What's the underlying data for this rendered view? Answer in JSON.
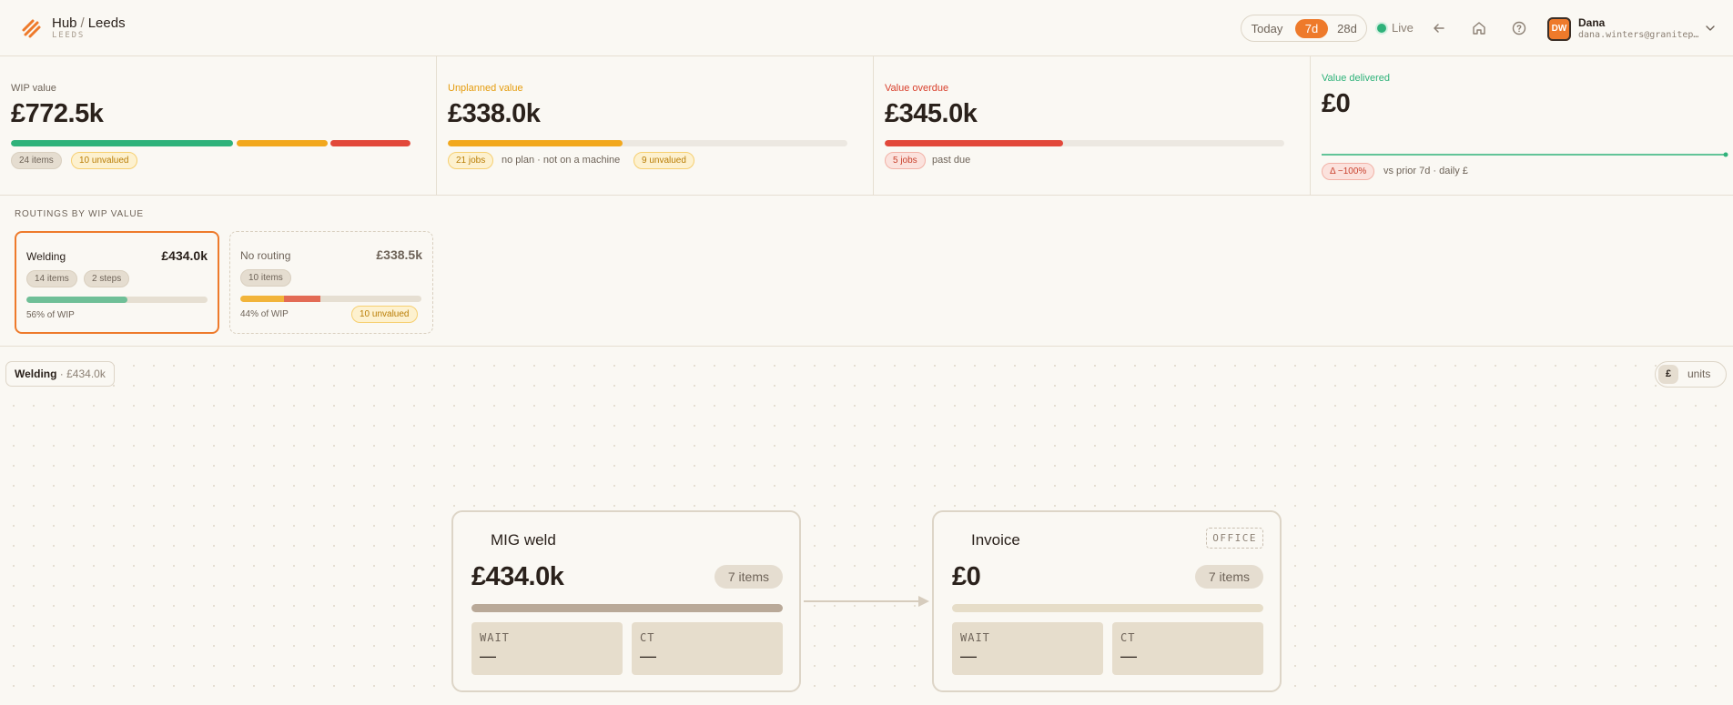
{
  "header": {
    "hub": "Hub",
    "site": "Leeds",
    "site_code": "LEEDS",
    "range": {
      "options": [
        "Today",
        "7d",
        "28d"
      ],
      "selected": "7d"
    },
    "live_label": "Live",
    "user": {
      "initials": "DW",
      "name": "Dana",
      "email": "dana.winters@granitep…"
    }
  },
  "kpis": [
    {
      "label": "WIP value",
      "label_color": "#6e6358",
      "value": "£772.5k",
      "pills": [
        "24 items",
        "10 unvalued"
      ]
    },
    {
      "label": "Unplanned value",
      "label_color": "#e59c0d",
      "value": "£338.0k",
      "pill1": "21 jobs",
      "note": "no plan · not on a machine",
      "pill2": "9 unvalued"
    },
    {
      "label": "Value overdue",
      "label_color": "#d9402d",
      "value": "£345.0k",
      "pill1": "5 jobs",
      "note": "past due"
    },
    {
      "label": "Value delivered",
      "label_color": "#2fb27a",
      "value": "£0",
      "pill1": "Δ −100%",
      "note": "vs prior 7d · daily £"
    }
  ],
  "routings": {
    "title": "ROUTINGS BY WIP VALUE",
    "cards": [
      {
        "name": "Welding",
        "value": "£434.0k",
        "pills": [
          "14 items",
          "2 steps"
        ],
        "footer": "56% of WIP",
        "wip_share": 0.56
      },
      {
        "name": "No routing",
        "value": "£338.5k",
        "pills": [
          "10 items"
        ],
        "footer": "44% of WIP",
        "unvalued": "10 unvalued"
      }
    ]
  },
  "canvas": {
    "chip_name": "Welding",
    "chip_value": "· £434.0k",
    "toggle": {
      "symbol": "£",
      "alt": "units"
    },
    "steps": [
      {
        "name": "MIG weld",
        "value": "£434.0k",
        "count": "7 items",
        "wait_label": "WAIT",
        "wait": "—",
        "ct_label": "CT",
        "ct": "—"
      },
      {
        "name": "Invoice",
        "badge": "OFFICE",
        "value": "£0",
        "count": "7 items",
        "wait_label": "WAIT",
        "wait": "—",
        "ct_label": "CT",
        "ct": "—"
      }
    ]
  },
  "colors": {
    "accent": "#ee7a2b",
    "green": "#2fb27a",
    "amber": "#f2a81d",
    "red": "#e2483a"
  }
}
